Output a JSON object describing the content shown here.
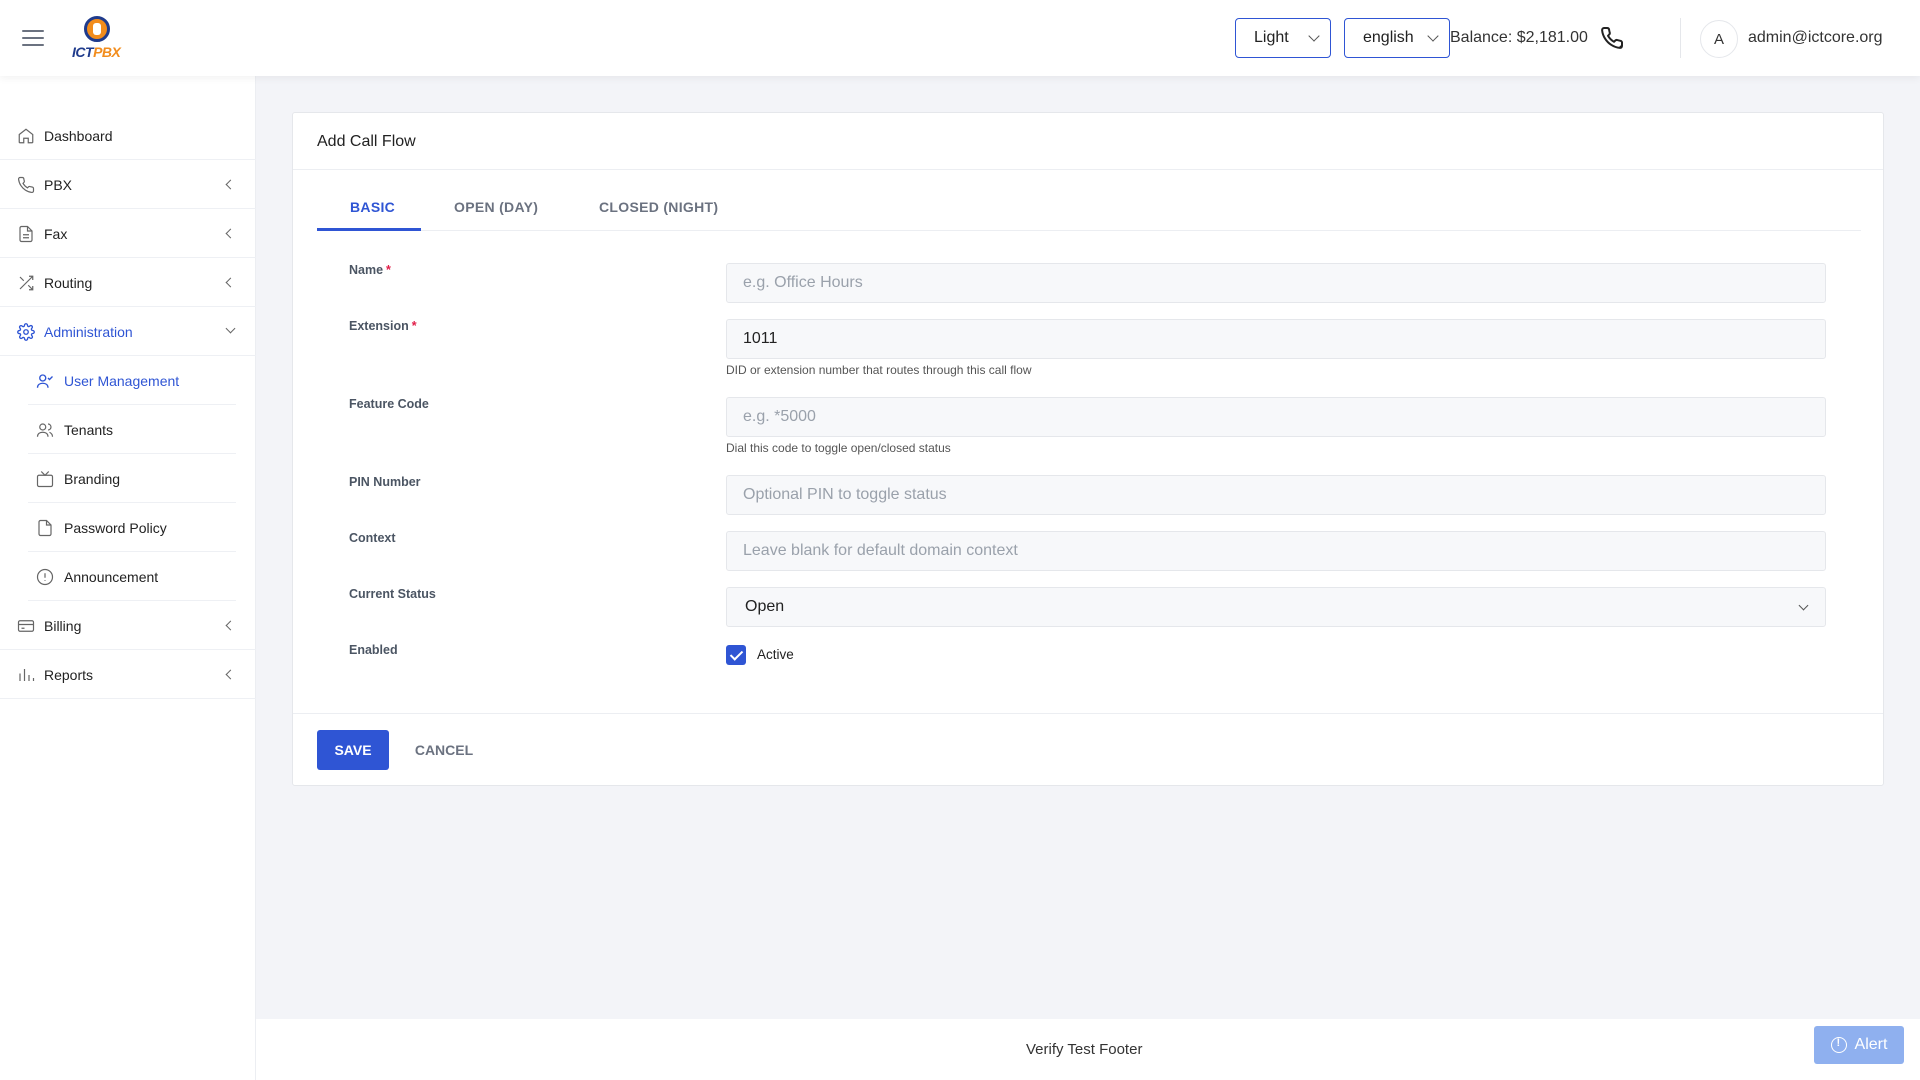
{
  "header": {
    "theme_value": "Light",
    "language_value": "english",
    "balance": "Balance: $2,181.00",
    "avatar_initial": "A",
    "user_email": "admin@ictcore.org",
    "logo_text_a": "ICT",
    "logo_text_b": "PBX"
  },
  "sidebar": {
    "items": [
      {
        "label": "Dashboard",
        "icon": "home-icon"
      },
      {
        "label": "PBX",
        "icon": "phone-icon"
      },
      {
        "label": "Fax",
        "icon": "document-icon"
      },
      {
        "label": "Routing",
        "icon": "shuffle-icon"
      },
      {
        "label": "Administration",
        "icon": "gear-icon"
      },
      {
        "label": "Billing",
        "icon": "credit-card-icon"
      },
      {
        "label": "Reports",
        "icon": "bar-chart-icon"
      }
    ],
    "sub_items": [
      {
        "label": "User Management",
        "icon": "user-check-icon"
      },
      {
        "label": "Tenants",
        "icon": "users-icon"
      },
      {
        "label": "Branding",
        "icon": "tv-icon"
      },
      {
        "label": "Password Policy",
        "icon": "file-icon"
      },
      {
        "label": "Announcement",
        "icon": "info-circle-icon"
      }
    ]
  },
  "card": {
    "title": "Add Call Flow",
    "tabs": [
      "BASIC",
      "OPEN (DAY)",
      "CLOSED (NIGHT)"
    ],
    "fields": {
      "name": {
        "label": "Name",
        "placeholder": "e.g. Office Hours",
        "value": ""
      },
      "extension": {
        "label": "Extension",
        "value": "1011",
        "help": "DID or extension number that routes through this call flow"
      },
      "feature_code": {
        "label": "Feature Code",
        "placeholder": "e.g. *5000",
        "help": "Dial this code to toggle open/closed status"
      },
      "pin": {
        "label": "PIN Number",
        "placeholder": "Optional PIN to toggle status"
      },
      "context": {
        "label": "Context",
        "placeholder": "Leave blank for default domain context"
      },
      "status": {
        "label": "Current Status",
        "value": "Open"
      },
      "enabled": {
        "label": "Enabled",
        "checkbox_label": "Active",
        "checked": true
      }
    },
    "required_mark": "*",
    "save_label": "SAVE",
    "cancel_label": "CANCEL"
  },
  "footer": {
    "text": "Verify Test Footer"
  },
  "alert": {
    "label": "Alert"
  },
  "colors": {
    "accent": "#2f55d4",
    "required": "#e11d48",
    "logo_orange": "#f28c1c",
    "logo_blue": "#1f3b8c"
  }
}
